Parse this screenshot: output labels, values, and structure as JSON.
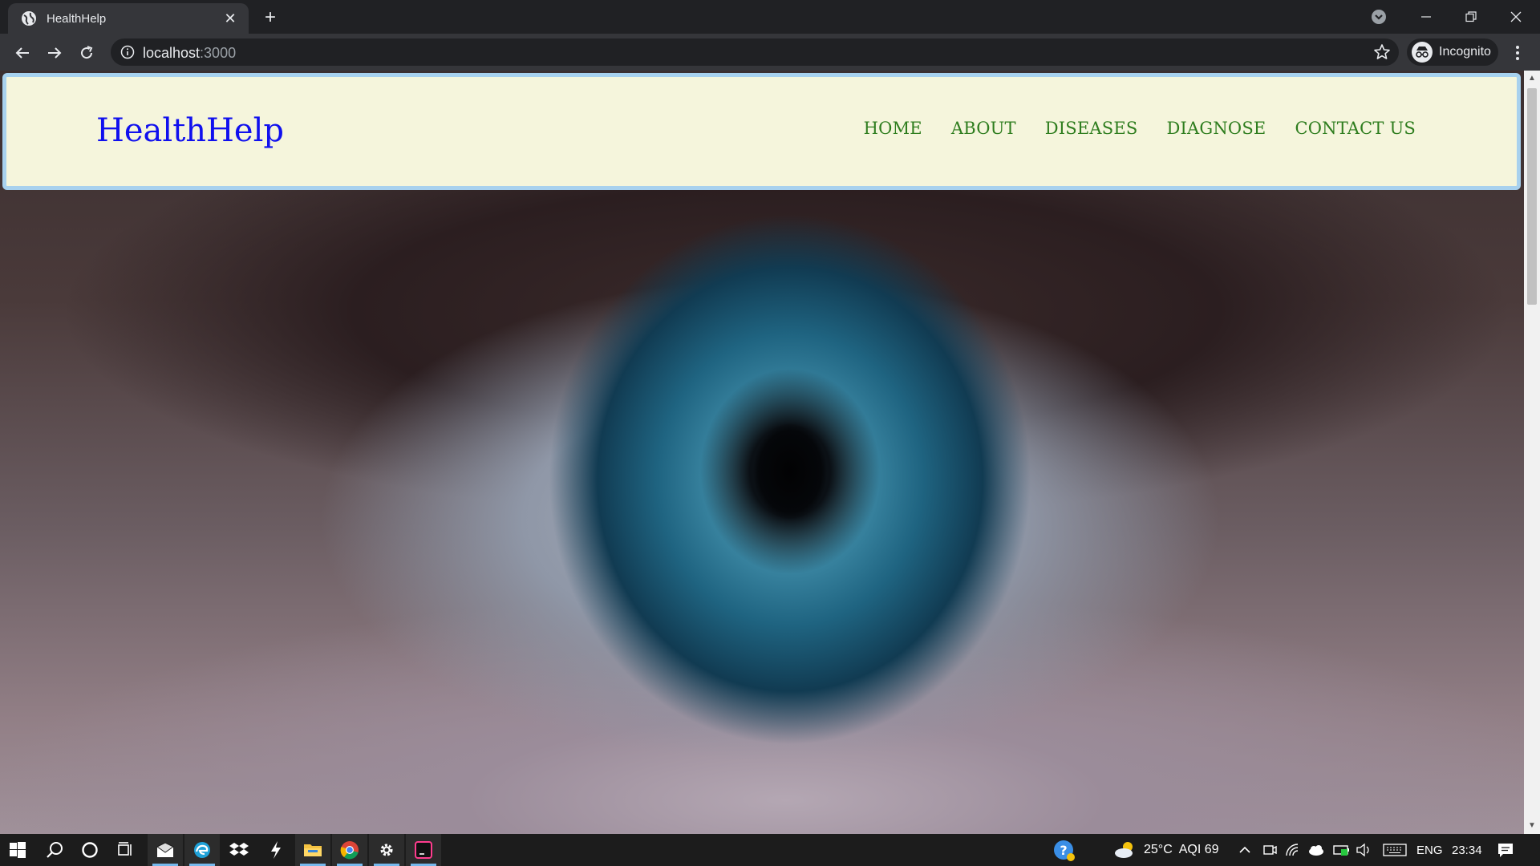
{
  "browser": {
    "tab_title": "HealthHelp",
    "url_host": "localhost",
    "url_port": ":3000",
    "profile_label": "Incognito"
  },
  "site": {
    "brand": "HealthHelp",
    "nav": [
      "HOME",
      "ABOUT",
      "DISEASES",
      "DIAGNOSE",
      "CONTACT US"
    ],
    "colors": {
      "header_bg": "#f5f5dc",
      "header_border": "#a8d1ee",
      "brand": "#1010ee",
      "nav": "#2e7d1e"
    },
    "hero_image": "close-up-blue-eye"
  },
  "taskbar": {
    "weather": "25°C",
    "aqi": "AQI 69",
    "language": "ENG",
    "time": "23:34"
  }
}
